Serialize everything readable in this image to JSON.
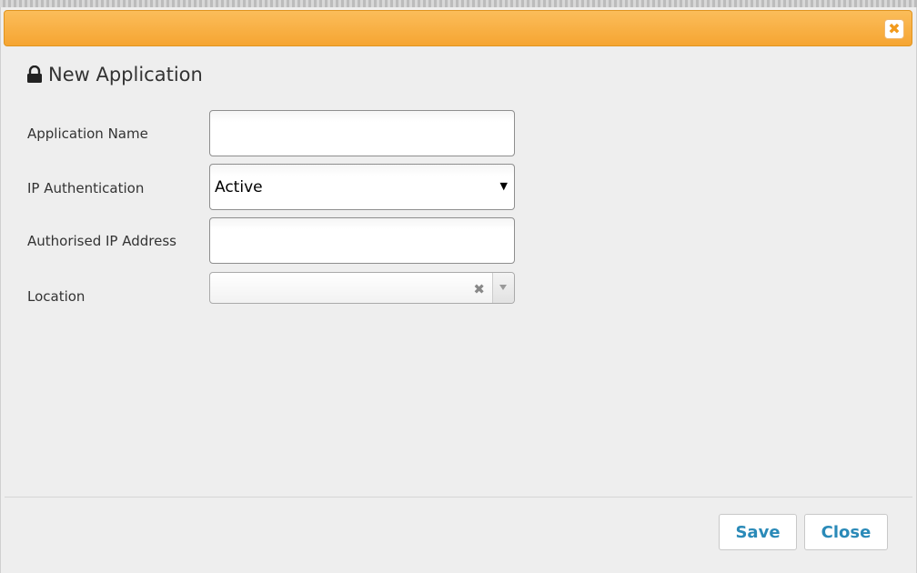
{
  "dialog": {
    "title": "New Application",
    "close_glyph": "✖"
  },
  "form": {
    "application_name": {
      "label": "Application Name",
      "value": ""
    },
    "ip_authentication": {
      "label": "IP Authentication",
      "selected": "Active",
      "arrow_glyph": "▼"
    },
    "authorised_ip": {
      "label": "Authorised IP Address",
      "value": ""
    },
    "location": {
      "label": "Location",
      "value": "",
      "clear_glyph": "✖"
    }
  },
  "footer": {
    "save_label": "Save",
    "close_label": "Close"
  },
  "icons": {
    "title_icon": "lock-icon",
    "titlebar_close": "close-icon",
    "select_arrow": "chevron-down-icon",
    "combo_clear": "clear-icon"
  },
  "colors": {
    "titlebar": "#f6a532",
    "button_text": "#2a8ab8",
    "background": "#eeeeee"
  }
}
